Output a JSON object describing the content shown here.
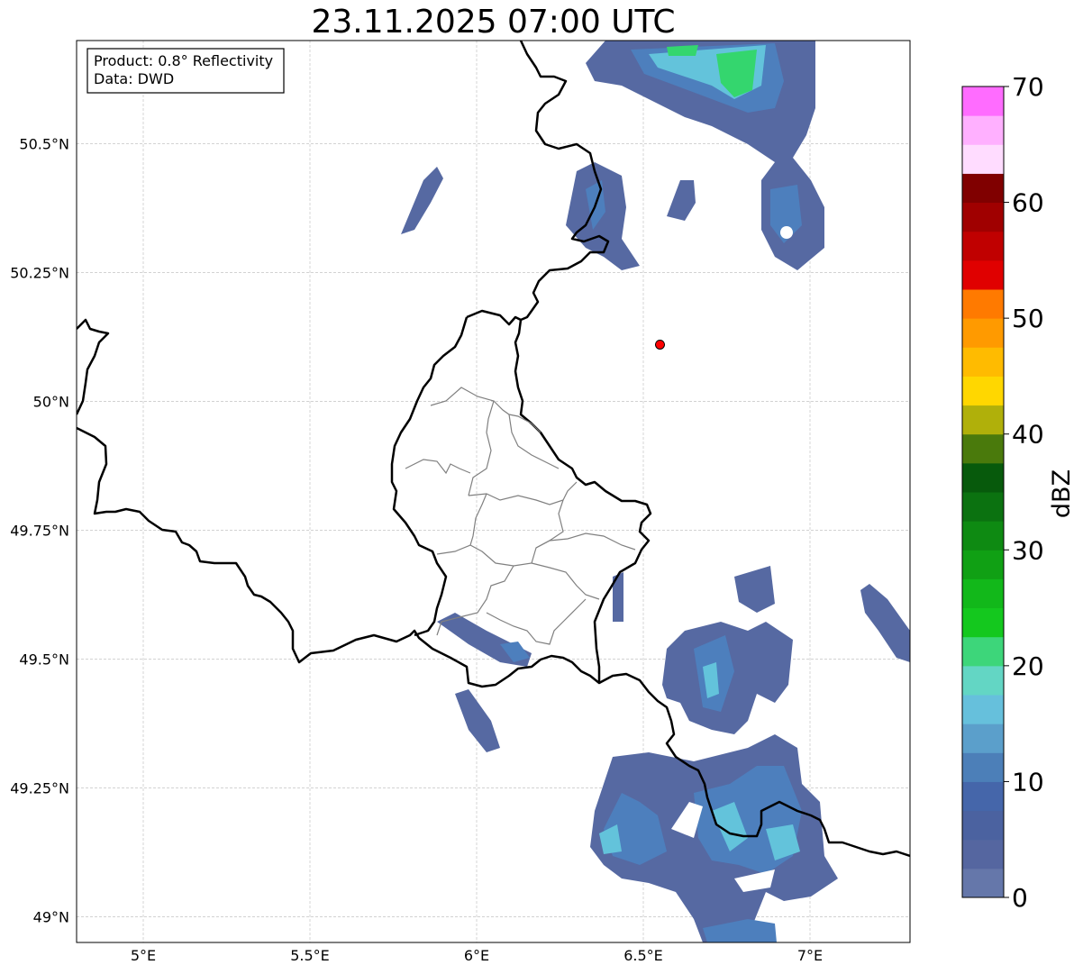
{
  "title": "23.11.2025 07:00 UTC",
  "info_box": {
    "product": "Product: 0.8° Reflectivity",
    "data": "Data: DWD"
  },
  "map": {
    "lon_range": [
      4.8,
      7.3
    ],
    "lat_range": [
      48.95,
      50.7
    ],
    "x_ticks": [
      "5°E",
      "5.5°E",
      "6°E",
      "6.5°E",
      "7°E"
    ],
    "y_ticks": [
      "50.5°N",
      "50.25°N",
      "50°N",
      "49.75°N",
      "49.5°N",
      "49.25°N",
      "49°N"
    ],
    "grid": true,
    "radar_site": {
      "lon": 6.55,
      "lat": 50.11,
      "color": "#ff0000"
    }
  },
  "colorbar": {
    "label": "dBZ",
    "ticks": [
      "0",
      "10",
      "20",
      "30",
      "40",
      "50",
      "60",
      "70"
    ],
    "range": [
      0,
      70
    ],
    "step": 2.5,
    "colors": [
      "#6577aa",
      "#5566a0",
      "#4b62a0",
      "#4566aa",
      "#4c7fb8",
      "#5b9fcb",
      "#66c0dc",
      "#63d6c4",
      "#3dd67a",
      "#14c81e",
      "#12b81a",
      "#10a014",
      "#0e8a12",
      "#0b7210",
      "#075a0c",
      "#4a7a0c",
      "#b0b00a",
      "#ffd700",
      "#ffbb00",
      "#ff9a00",
      "#ff7a00",
      "#e00000",
      "#c00000",
      "#a00000",
      "#800000",
      "#ffdcff",
      "#ffb0ff",
      "#ff6cff",
      "#ee33ee"
    ]
  },
  "colors": {
    "echo_weak": "#5669a2",
    "echo_mid": "#4d7fbd",
    "echo_cyan": "#63c3db",
    "echo_green": "#34d66e",
    "border_national": "#000000",
    "border_regional": "#808080"
  }
}
